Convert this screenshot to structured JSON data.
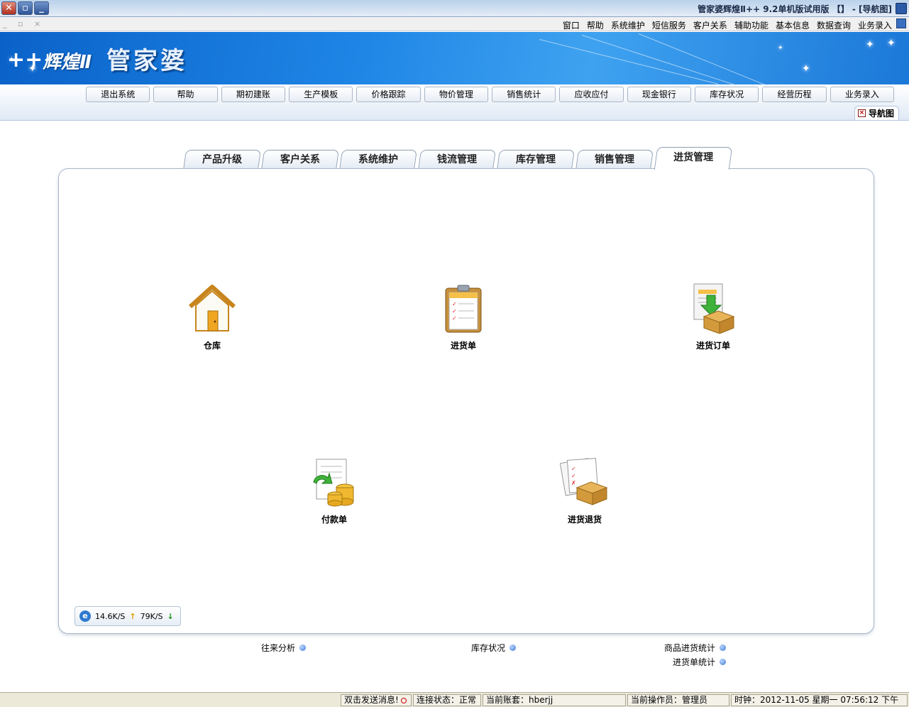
{
  "window": {
    "title": "管家婆辉煌Ⅱ++ 9.2单机版试用版 【】 - [导航图]"
  },
  "menubar": {
    "items": [
      "业务录入",
      "数据查询",
      "基本信息",
      "辅助功能",
      "客户关系",
      "短信服务",
      "系统维护",
      "帮助",
      "窗口"
    ],
    "mdi_buttons": "_ ▫ ×"
  },
  "banner": {
    "logo": "管家婆",
    "logo_sub": "辉煌Ⅱ",
    "logo_plus": "++"
  },
  "toolbar": {
    "buttons": [
      "业务录入",
      "经营历程",
      "库存状况",
      "现金银行",
      "应收应付",
      "销售统计",
      "物价管理",
      "价格跟踪",
      "生产模板",
      "期初建账",
      "帮助",
      "退出系统"
    ],
    "doc_tab_label": "导航图"
  },
  "tabs": {
    "items": [
      "进货管理",
      "销售管理",
      "库存管理",
      "钱流管理",
      "系统维护",
      "客户关系",
      "产品升级"
    ],
    "active": "进货管理"
  },
  "functions": [
    {
      "label": "进货订单",
      "icon": "order-box-icon"
    },
    {
      "label": "进货单",
      "icon": "clipboard-icon"
    },
    {
      "label": "仓库",
      "icon": "house-icon"
    },
    {
      "label": "进货退货",
      "icon": "return-box-icon"
    },
    {
      "label": "付款单",
      "icon": "payment-coins-icon"
    }
  ],
  "speed": {
    "down": "79K/S",
    "up": "14.6K/S"
  },
  "sublinks": [
    "商品进货统计",
    "进货单统计",
    "库存状况",
    "往来分析"
  ],
  "statusbar": {
    "clock": "时钟：2012-11-05 星期一 07:56:12 下午",
    "operator": "当前操作员：管理员",
    "account": "当前账套：hberjj",
    "connection": "连接状态：正常",
    "message": "双击发送消息!"
  }
}
